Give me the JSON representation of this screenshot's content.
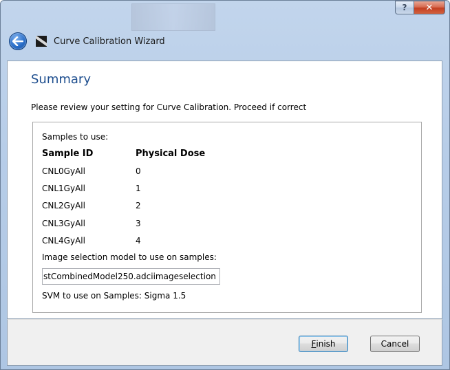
{
  "window": {
    "title": "Curve Calibration Wizard",
    "help_glyph": "?",
    "close_glyph": "✕"
  },
  "page": {
    "heading": "Summary",
    "instruction": "Please review your setting for Curve Calibration. Proceed if correct"
  },
  "summary": {
    "samples_label": "Samples to use:",
    "columns": [
      "Sample ID",
      "Physical Dose"
    ],
    "rows": [
      {
        "id": "CNL0GyAll",
        "dose": "0"
      },
      {
        "id": "CNL1GyAll",
        "dose": "1"
      },
      {
        "id": "CNL2GyAll",
        "dose": "2"
      },
      {
        "id": "CNL3GyAll",
        "dose": "3"
      },
      {
        "id": "CNL4GyAll",
        "dose": "4"
      }
    ],
    "model_label": "Image selection model to use on samples:",
    "model_value": "stCombinedModel250.adciimageselection",
    "svm_line": "SVM to use on Samples: Sigma 1.5"
  },
  "buttons": {
    "finish_first": "F",
    "finish_rest": "inish",
    "cancel": "Cancel"
  },
  "colors": {
    "accent": "#1f4f8f",
    "glass": "#b7cde8",
    "close": "#c33f22"
  },
  "icons": [
    "back-arrow-icon",
    "app-icon",
    "help-icon",
    "close-icon"
  ]
}
